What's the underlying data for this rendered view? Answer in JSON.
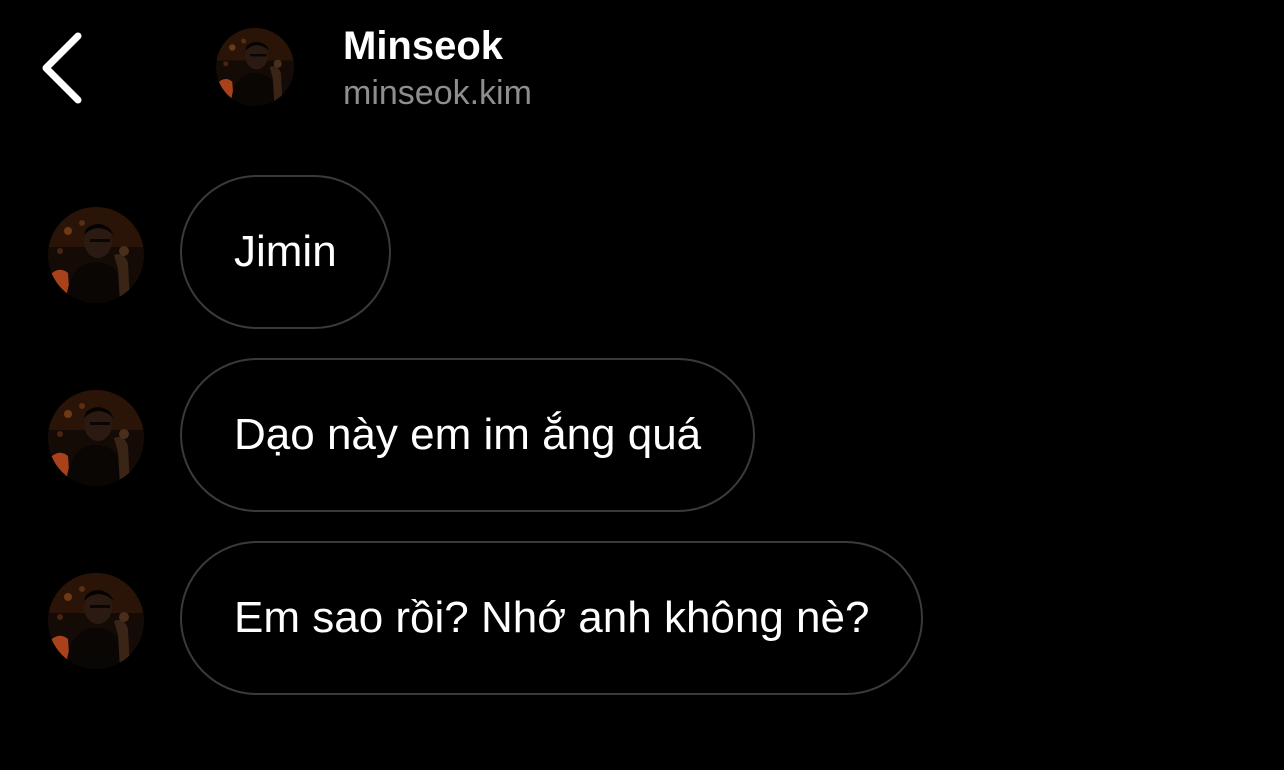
{
  "header": {
    "back_icon": "chevron-left-icon",
    "name": "Minseok",
    "username": "minseok.kim",
    "avatar_icon": "profile-photo"
  },
  "messages": [
    {
      "text": "Jimin"
    },
    {
      "text": "Dạo này em im ắng quá"
    },
    {
      "text": "Em sao rồi? Nhớ anh không nè?"
    }
  ],
  "colors": {
    "background": "#000000",
    "text": "#ffffff",
    "secondary_text": "#8e8e8e",
    "bubble_border": "#3a3a3a"
  }
}
